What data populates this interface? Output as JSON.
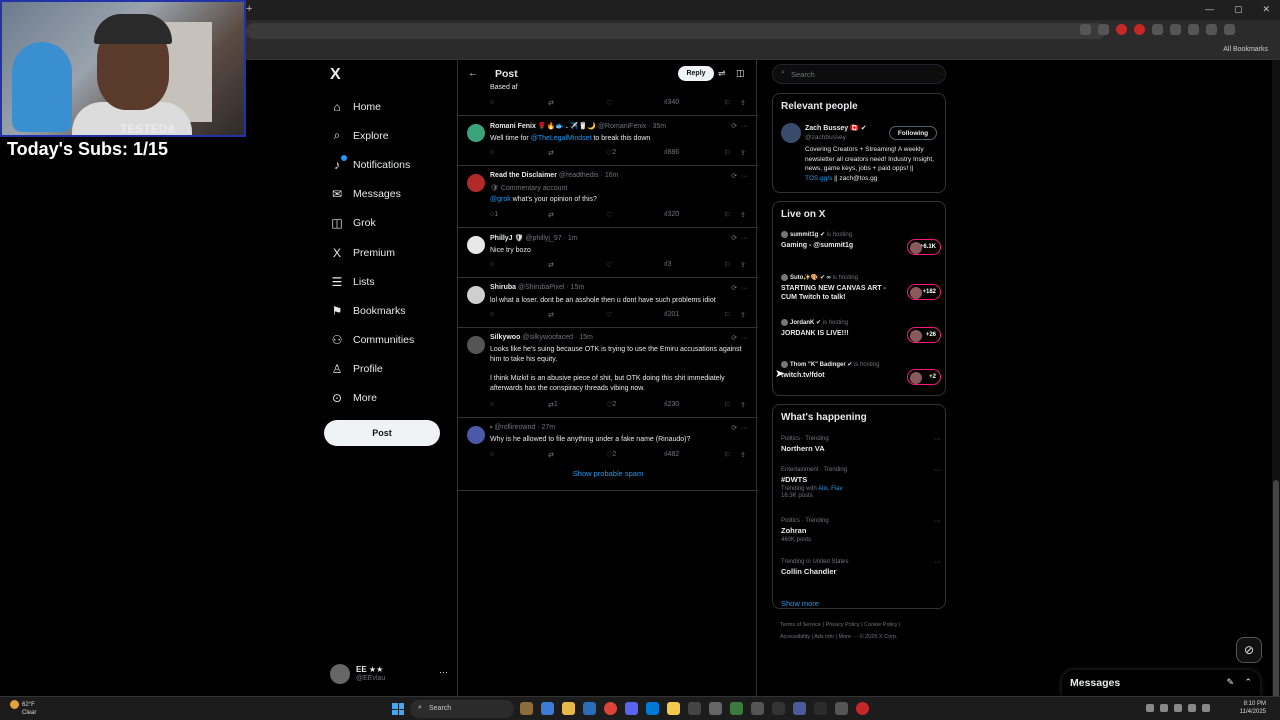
{
  "overlay": {
    "subs_text": "Today's Subs: 1/15",
    "watermark": "TESTED&"
  },
  "browser": {
    "all_bookmarks": "All Bookmarks",
    "new_tab": "+"
  },
  "nav": {
    "logo": "X",
    "items": [
      {
        "label": "Home",
        "icon": "⌂"
      },
      {
        "label": "Explore",
        "icon": "⌕"
      },
      {
        "label": "Notifications",
        "icon": "♪"
      },
      {
        "label": "Messages",
        "icon": "✉"
      },
      {
        "label": "Grok",
        "icon": "◫"
      },
      {
        "label": "Premium",
        "icon": "X"
      },
      {
        "label": "Lists",
        "icon": "☰"
      },
      {
        "label": "Bookmarks",
        "icon": "⚑"
      },
      {
        "label": "Communities",
        "icon": "⚇"
      },
      {
        "label": "Profile",
        "icon": "♙"
      },
      {
        "label": "More",
        "icon": "⊙"
      }
    ],
    "post_label": "Post"
  },
  "account": {
    "name": "EE ★★",
    "handle": "@EEvlau",
    "more": "···"
  },
  "thread": {
    "title": "Post",
    "reply_label": "Reply",
    "partial_text": "Based af",
    "first_views": "340",
    "show_spam": "Show probable spam",
    "tweets": [
      {
        "name": "Romani Fenix 🌹🔥🐟 . ✈️🥛🌙",
        "meta": "@RomaniFenix · 35m",
        "body_pre": "Well time for ",
        "mention": "@TheLegalMindset",
        "body_post": " to break this down",
        "replies": "",
        "reposts": "",
        "likes": "2",
        "views": "886",
        "avatar_color": "#3aa57a"
      },
      {
        "name": "Read the Disclaimer",
        "meta": "@readthedis · 16m",
        "sub": "🛡 Commentary account",
        "mention": "@grok",
        "body_post": " what's your opinion of this?",
        "replies": "1",
        "reposts": "",
        "likes": "",
        "views": "320",
        "avatar_color": "#b02a2a"
      },
      {
        "name": "PhillyJ 🛡",
        "meta": "@phillyj_97 · 1m",
        "body": "Nice try bozo",
        "views": "3",
        "avatar_color": "#e8e8e8"
      },
      {
        "name": "Shiruba",
        "meta": "@ShirubaPixel · 15m",
        "body": "lol what a loser. dont be an asshole then u dont have such problems idiot",
        "views": "201",
        "avatar_color": "#cfcfcf"
      },
      {
        "name": "Silkywoo",
        "meta": "@silkywoofaced · 15m",
        "body1": "Looks like he's suing because OTK is trying to use the Emiru accusations against him to take his equity.",
        "body2": "I think Mizkif is an abusive piece of shit, but OTK doing this shit immediately afterwards has the conspiracy threads vibing now.",
        "reposts": "1",
        "likes": "2",
        "views": "230",
        "avatar_color": "#555"
      },
      {
        "name": "-",
        "meta": "@rollinrownd · 27m",
        "body": "Why is he allowed to file anything under a fake name (Rinaudo)?",
        "likes": "2",
        "views": "482",
        "avatar_color": "#4a5aa8"
      }
    ]
  },
  "sidebar": {
    "search_placeholder": "Search",
    "relevant": {
      "title": "Relevant people",
      "name": "Zach Bussey 🇨🇦 ✔",
      "handle": "@zachbussey",
      "follow_label": "Following",
      "bio_pre": "Covering Creators + Streaming! A weekly newsletter all creators need! Industry Insight, news, game keys, jobs + paid opps! || ",
      "bio_link": "TOS.gg/s",
      "bio_post": " || zach@tos.gg"
    },
    "live": {
      "title": "Live on X",
      "items": [
        {
          "host": "summit1g ✔",
          "status": "is hosting",
          "title": "Gaming - @summit1g",
          "count": "+6.1K"
        },
        {
          "host": "Suto✨🎨 ✔ ∞",
          "status": "is hosting",
          "title": "STARTING NEW CANVAS ART - CUM Twitch to talk!",
          "count": "+182"
        },
        {
          "host": "JordanK ✔",
          "status": "is hosting",
          "title": "JORDANK IS LIVE!!!",
          "count": "+26"
        },
        {
          "host": "Thom \"K\" Badinger ✔",
          "status": "is hosting",
          "title": "twitch.tv/fdot",
          "count": "+2"
        }
      ]
    },
    "happening": {
      "title": "What's happening",
      "items": [
        {
          "context": "Politics · Trending",
          "topic": "Northern VA",
          "extra": ""
        },
        {
          "context": "Entertainment · Trending",
          "topic": "#DWTS",
          "extra_pre": "Trending with ",
          "extra_links": "Alix, Flav",
          "extra": "16.3K posts"
        },
        {
          "context": "Politics · Trending",
          "topic": "Zohran",
          "extra": "460K posts"
        },
        {
          "context": "Trending in United States",
          "topic": "Collin Chandler",
          "extra": ""
        }
      ],
      "show_more": "Show more"
    },
    "footer": {
      "line1": "Terms of Service  |  Privacy Policy  |  Cookie Policy  |",
      "line2": "Accessibility  |  Ads info  |  More ···  © 2025 X Corp."
    }
  },
  "messages_drawer": {
    "title": "Messages"
  },
  "taskbar": {
    "temp": "62°F",
    "weather": "Clear",
    "search_label": "Search",
    "time": "8:10 PM",
    "date": "11/4/2025",
    "notif_badge": "1"
  },
  "colors": {
    "accent": "#1d9bf0",
    "background": "#000000",
    "live_ring": "#f91880"
  }
}
